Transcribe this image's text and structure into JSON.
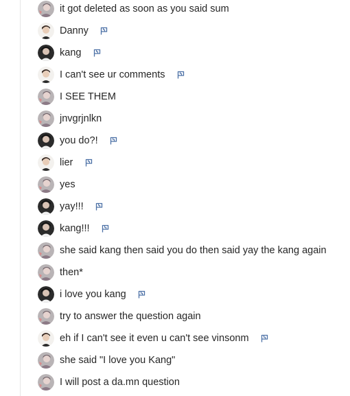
{
  "comments": [
    {
      "avatar": "avatar-grey-user",
      "text": "it got deleted as soon as you said sum",
      "flag": false
    },
    {
      "avatar": "avatar-light-user",
      "text": "Danny",
      "flag": true
    },
    {
      "avatar": "avatar-dark-user",
      "text": "kang",
      "flag": true
    },
    {
      "avatar": "avatar-light-user",
      "text": "I can't see ur comments",
      "flag": true
    },
    {
      "avatar": "avatar-grey-user",
      "text": "I SEE THEM",
      "flag": false
    },
    {
      "avatar": "avatar-grey-user",
      "text": "jnvgrjnlkn",
      "flag": false
    },
    {
      "avatar": "avatar-dark-user",
      "text": "you do?!",
      "flag": true
    },
    {
      "avatar": "avatar-light-user",
      "text": "lier",
      "flag": true
    },
    {
      "avatar": "avatar-grey-user",
      "text": "yes",
      "flag": false
    },
    {
      "avatar": "avatar-dark-user",
      "text": "yay!!!",
      "flag": true
    },
    {
      "avatar": "avatar-dark-user",
      "text": "kang!!!",
      "flag": true
    },
    {
      "avatar": "avatar-grey-user",
      "text": "she said kang then said you do then said yay the kang again",
      "flag": false
    },
    {
      "avatar": "avatar-grey-user",
      "text": "then*",
      "flag": false
    },
    {
      "avatar": "avatar-dark-user",
      "text": "i love you kang",
      "flag": true
    },
    {
      "avatar": "avatar-grey-user",
      "text": "try to answer the question again",
      "flag": false
    },
    {
      "avatar": "avatar-light-user",
      "text": "eh if I can't see it even u can't see vinsonm",
      "flag": true
    },
    {
      "avatar": "avatar-grey-user",
      "text": "she said \"I love you Kang\"",
      "flag": false
    },
    {
      "avatar": "avatar-grey-user",
      "text": "I will post a da.mn question",
      "flag": false
    }
  ],
  "colors": {
    "flag": "#4a6fa5",
    "thread_line": "#e5e5e5",
    "text": "#262626"
  },
  "icons": {
    "flag": "flag-icon"
  }
}
